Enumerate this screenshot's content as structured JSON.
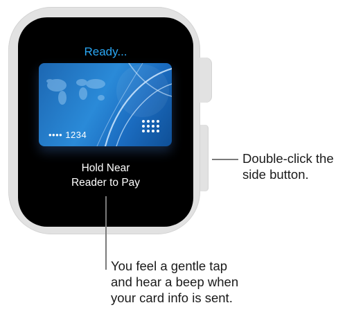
{
  "screen": {
    "status_text": "Ready...",
    "card_number": "•••• 1234",
    "instruction_line1": "Hold Near",
    "instruction_line2": "Reader to Pay"
  },
  "callouts": {
    "side_button": [
      "Double-click the",
      "side button."
    ],
    "tap_beep": [
      "You feel a gentle tap",
      "and hear a beep when",
      "your card info is sent."
    ]
  },
  "colors": {
    "status_text": "#2aa7f4",
    "card": "#1f78c8",
    "watch_case": "#e2e2e2",
    "screen": "#000000"
  }
}
